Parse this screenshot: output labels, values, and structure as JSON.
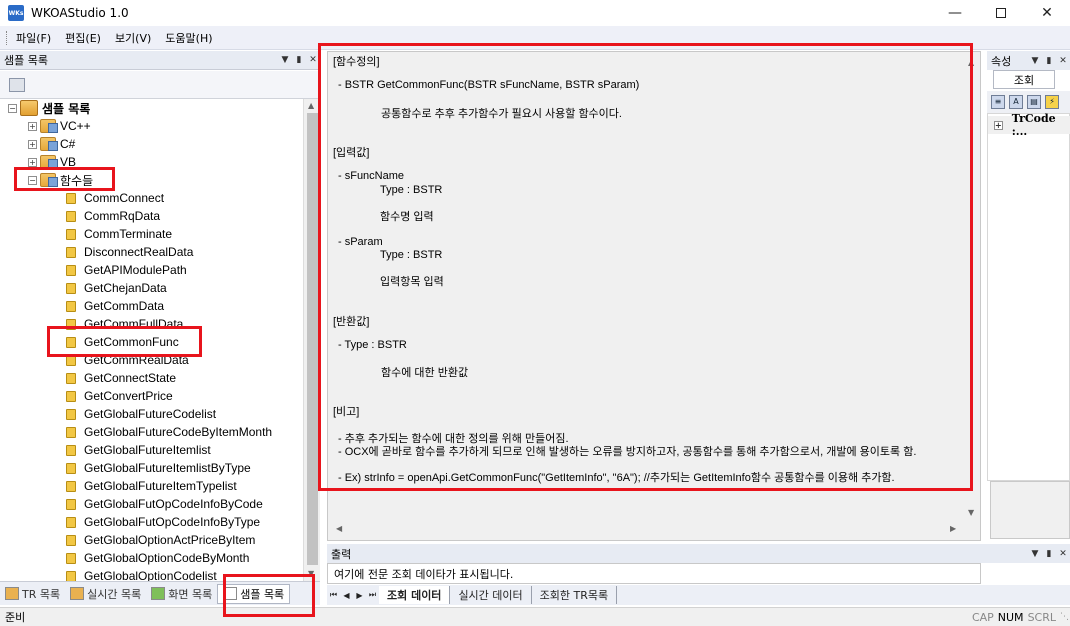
{
  "window": {
    "title": "WKOAStudio 1.0",
    "icon_text": "WKs",
    "minimize_icon": "minimize-icon",
    "maximize_icon": "maximize-icon",
    "close_icon": "close-icon"
  },
  "menu": [
    "파일(F)",
    "편집(E)",
    "보기(V)",
    "도움말(H)"
  ],
  "left_panel": {
    "title": "샘플 목록",
    "tree": {
      "root": "샘플 목록",
      "groups": [
        "VC++",
        "C#",
        "VB",
        "함수들"
      ],
      "functions": [
        "CommConnect",
        "CommRqData",
        "CommTerminate",
        "DisconnectRealData",
        "GetAPIModulePath",
        "GetChejanData",
        "GetCommData",
        "GetCommFullData",
        "GetCommonFunc",
        "GetCommRealData",
        "GetConnectState",
        "GetConvertPrice",
        "GetGlobalFutureCodelist",
        "GetGlobalFutureCodeByItemMonth",
        "GetGlobalFutureItemlist",
        "GetGlobalFutureItemlistByType",
        "GetGlobalFutureItemTypelist",
        "GetGlobalFutOpCodeInfoByCode",
        "GetGlobalFutOpCodeInfoByType",
        "GetGlobalOptionActPriceByItem",
        "GetGlobalOptionCodeByMonth",
        "GetGlobalOptionCodelist"
      ]
    },
    "tabs": [
      "TR 목록",
      "실시간 목록",
      "화면 목록",
      "샘플 목록"
    ],
    "active_tab": "샘플 목록"
  },
  "content": {
    "section_def": "[함수정의]",
    "signature": "- BSTR GetCommonFunc(BSTR sFuncName, BSTR sParam)",
    "description": "공통함수로 추후 추가함수가 필요시 사용할 함수이다.",
    "section_input": "[입력값]",
    "param1_name": "- sFuncName",
    "param1_type": "Type : BSTR",
    "param1_desc": "함수명 입력",
    "param2_name": "- sParam",
    "param2_type": "Type : BSTR",
    "param2_desc": "입력항목 입력",
    "section_return": "[반환값]",
    "return_type": "- Type : BSTR",
    "return_desc": "함수에 대한 반환값",
    "section_note": "[비고]",
    "note1": "- 추후 추가되는 함수에 대한 정의를 위해 만들어짐.",
    "note2": "- OCX에 곧바로 함수를 추가하게 되므로 인해 발생하는 오류를 방지하고자, 공통함수를 통해 추가함으로서, 개발에 용이토록 함.",
    "example": "- Ex) strInfo = openApi.GetCommonFunc(\"GetItemInfo\", \"6A\");  //추가되는 GetItemInfo함수 공통함수를 이용해 추가함."
  },
  "output": {
    "title": "출력",
    "message": "여기에 전문 조회 데이타가 표시됩니다.",
    "tabs": [
      "조회 데이터",
      "실시간 데이터",
      "조회한 TR목록"
    ],
    "active_tab": "조회 데이터"
  },
  "properties": {
    "title": "속성",
    "tab": "조회",
    "row": "TrCode :..."
  },
  "status": {
    "ready": "준비",
    "cap": "CAP",
    "num": "NUM",
    "scrl": "SCRL"
  },
  "highlight_color": "#e8141c"
}
